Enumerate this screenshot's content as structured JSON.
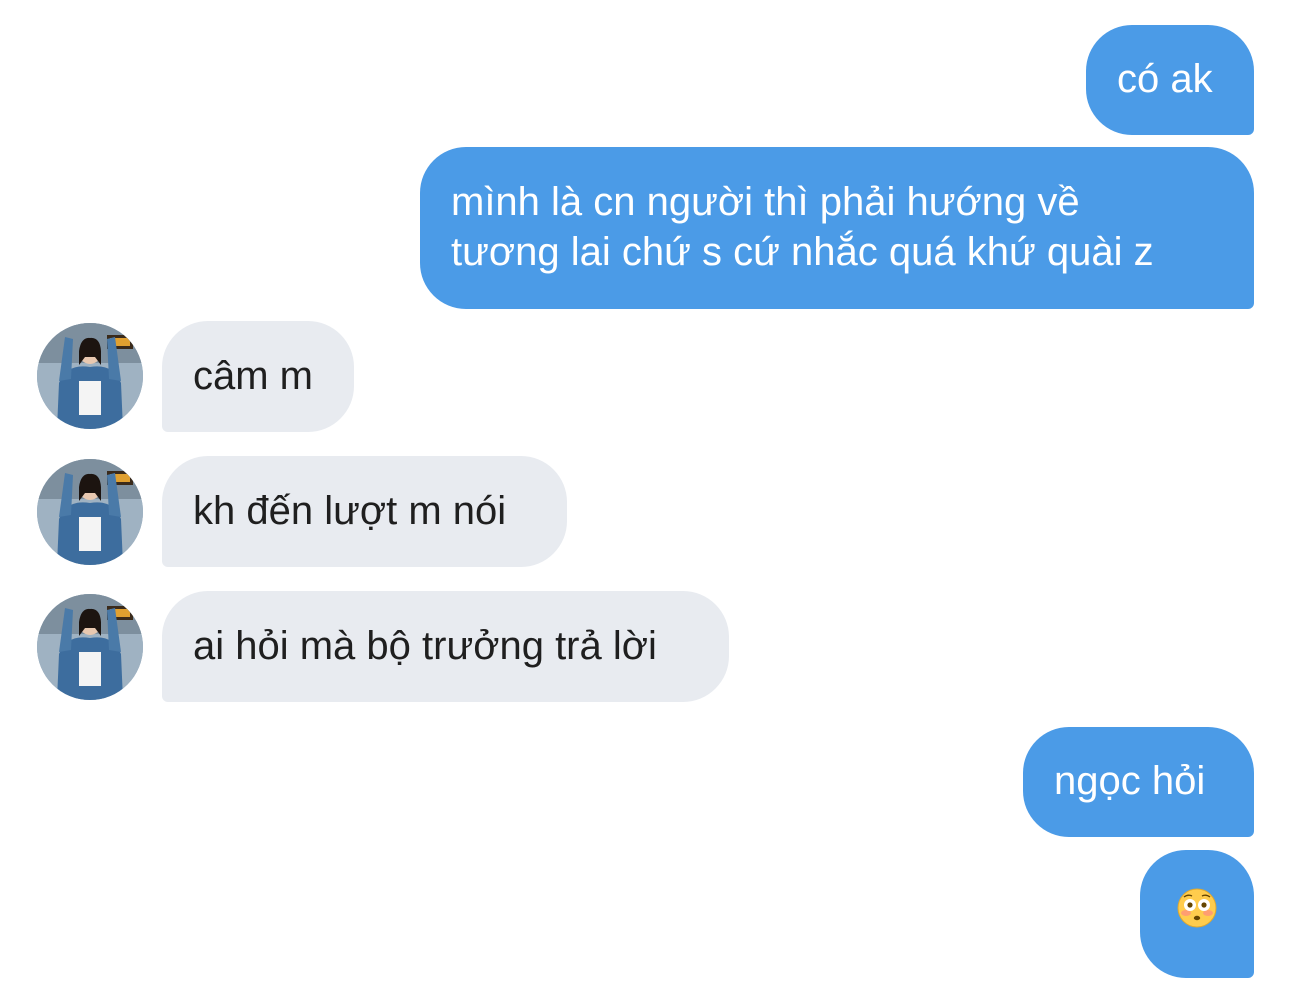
{
  "conversation": {
    "messages": [
      {
        "sender": "me",
        "text": "có ak"
      },
      {
        "sender": "me",
        "lines": [
          "mình là cn người thì phải hướng về",
          "tương lai chứ s cứ nhắc quá khứ quài z"
        ]
      },
      {
        "sender": "other",
        "text": "câm m",
        "avatar_icon": "contact-avatar-photo"
      },
      {
        "sender": "other",
        "text": "kh đến lượt m nói",
        "avatar_icon": "contact-avatar-photo"
      },
      {
        "sender": "other",
        "text": "ai hỏi mà bộ trưởng trả lời",
        "avatar_icon": "contact-avatar-photo"
      },
      {
        "sender": "me",
        "text": "ngọc hỏi"
      },
      {
        "sender": "me",
        "text": "😳",
        "icon": "flushed-face-emoji"
      }
    ]
  },
  "colors": {
    "sent_bubble": "#4b9be7",
    "received_bubble": "#e8ebf0",
    "sent_text": "#ffffff",
    "received_text": "#1f1f1f"
  }
}
